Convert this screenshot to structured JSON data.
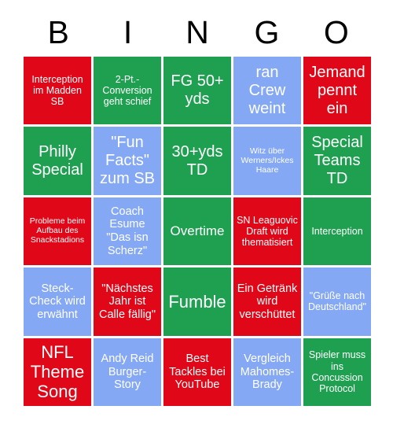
{
  "card": {
    "title": "BINGO",
    "header_letters": [
      "B",
      "I",
      "N",
      "G",
      "O"
    ],
    "colors": {
      "red": "#E00718",
      "green": "#1FA051",
      "blue": "#85A8F4",
      "text": "#FFFFFF",
      "header_text": "#000000",
      "background": "#FFFFFF"
    },
    "grid_size": {
      "columns": 5,
      "rows": 5
    },
    "cells": [
      {
        "text": "Interception im Madden SB",
        "color": "red",
        "size": "sm"
      },
      {
        "text": "2-Pt.-Conversion geht schief",
        "color": "green",
        "size": "sm"
      },
      {
        "text": "FG 50+ yds",
        "color": "green",
        "size": "xl"
      },
      {
        "text": "ran Crew weint",
        "color": "blue",
        "size": "xl"
      },
      {
        "text": "Jemand pennt ein",
        "color": "red",
        "size": "xl"
      },
      {
        "text": "Philly Special",
        "color": "green",
        "size": "xl"
      },
      {
        "text": "\"Fun Facts\" zum SB",
        "color": "blue",
        "size": "xl"
      },
      {
        "text": "30+yds TD",
        "color": "green",
        "size": "xl"
      },
      {
        "text": "Witz über Werners/Ickes Haare",
        "color": "blue",
        "size": "xs"
      },
      {
        "text": "Special Teams TD",
        "color": "green",
        "size": "xl"
      },
      {
        "text": "Probleme beim Aufbau des Snackstadions",
        "color": "red",
        "size": "xs"
      },
      {
        "text": "Coach Esume \"Das isn Scherz\"",
        "color": "blue",
        "size": "md"
      },
      {
        "text": "Overtime",
        "color": "green",
        "size": "lg"
      },
      {
        "text": "SN Leaguovic Draft wird thematisiert",
        "color": "red",
        "size": "sm"
      },
      {
        "text": "Interception",
        "color": "green",
        "size": "sm"
      },
      {
        "text": "Steck-Check wird erwähnt",
        "color": "blue",
        "size": "md"
      },
      {
        "text": "\"Nächstes Jahr ist Calle fällig\"",
        "color": "red",
        "size": "md"
      },
      {
        "text": "Fumble",
        "color": "green",
        "size": "xxl"
      },
      {
        "text": "Ein Getränk wird verschüttet",
        "color": "red",
        "size": "md"
      },
      {
        "text": "\"Grüße nach Deutschland\"",
        "color": "blue",
        "size": "sm"
      },
      {
        "text": "NFL Theme Song",
        "color": "red",
        "size": "xxl"
      },
      {
        "text": "Andy Reid Burger-Story",
        "color": "blue",
        "size": "md"
      },
      {
        "text": "Best Tackles bei YouTube",
        "color": "red",
        "size": "md"
      },
      {
        "text": "Vergleich Mahomes-Brady",
        "color": "blue",
        "size": "md"
      },
      {
        "text": "Spieler muss ins Concussion Protocol",
        "color": "green",
        "size": "sm"
      }
    ]
  }
}
